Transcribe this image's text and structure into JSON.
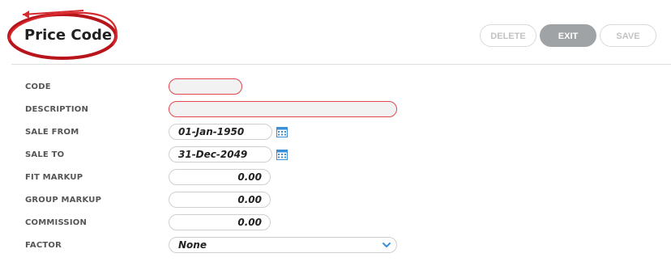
{
  "header": {
    "title": "Price Code",
    "buttons": {
      "delete": "DELETE",
      "exit": "EXIT",
      "save": "SAVE"
    }
  },
  "form": {
    "code": {
      "label": "CODE",
      "value": ""
    },
    "description": {
      "label": "DESCRIPTION",
      "value": ""
    },
    "sale_from": {
      "label": "SALE FROM",
      "value": "01-Jan-1950"
    },
    "sale_to": {
      "label": "SALE TO",
      "value": "31-Dec-2049"
    },
    "fit_markup": {
      "label": "FIT MARKUP",
      "value": "0.00"
    },
    "group_markup": {
      "label": "GROUP MARKUP",
      "value": "0.00"
    },
    "commission": {
      "label": "COMMISSION",
      "value": "0.00"
    },
    "factor": {
      "label": "FACTOR",
      "value": "None"
    }
  },
  "colors": {
    "accent_blue": "#3a8fd8",
    "invalid_border": "#e0474c",
    "annotation_red": "#c0121a"
  },
  "icons": [
    "calendar-icon",
    "chevron-down-icon"
  ]
}
